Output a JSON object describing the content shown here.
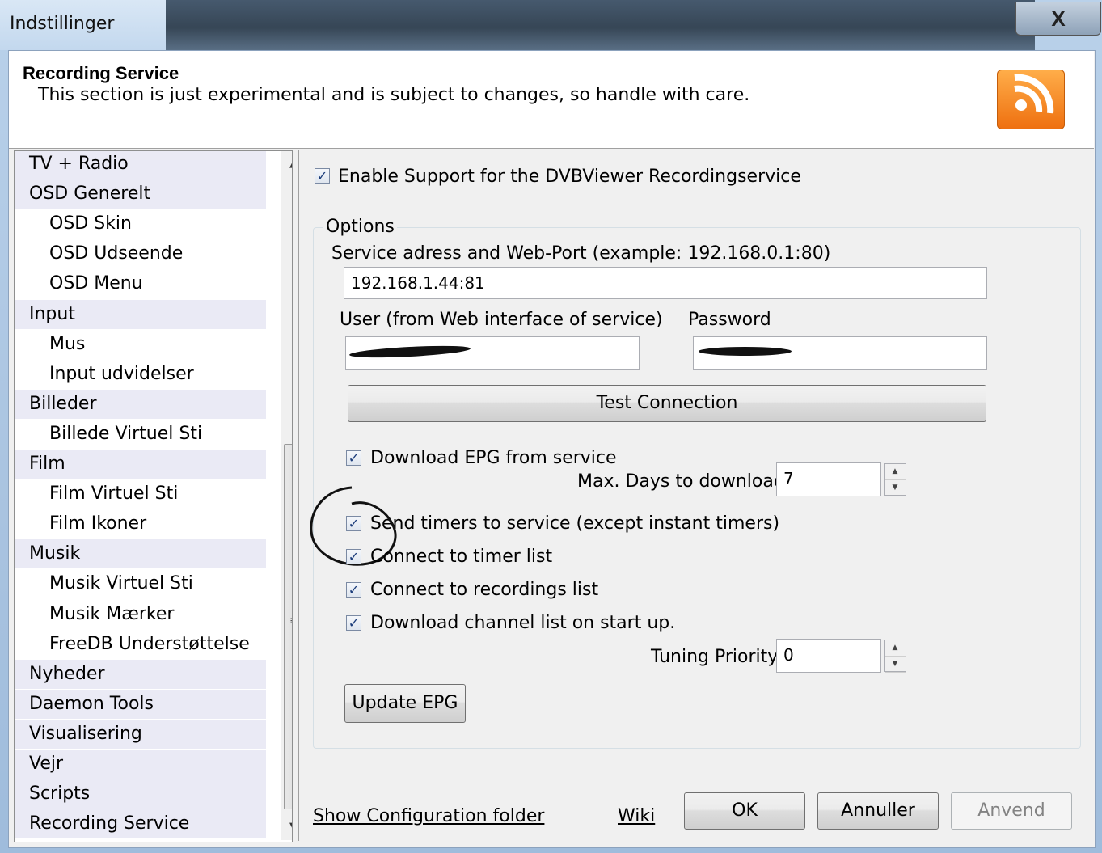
{
  "window": {
    "title": "Indstillinger",
    "close_glyph": "X"
  },
  "header": {
    "title": "Recording Service",
    "subtitle": "This section is just experimental and is subject to changes, so handle with care.",
    "logo_icon": "rss-feed-icon",
    "logo_color": "#f7891f"
  },
  "tree": {
    "items": [
      {
        "label": "TV + Radio",
        "level": 0
      },
      {
        "label": "OSD Generelt",
        "level": 0
      },
      {
        "label": "OSD Skin",
        "level": 1
      },
      {
        "label": "OSD Udseende",
        "level": 1
      },
      {
        "label": "OSD Menu",
        "level": 1
      },
      {
        "label": "Input",
        "level": 0
      },
      {
        "label": "Mus",
        "level": 1
      },
      {
        "label": "Input udvidelser",
        "level": 1
      },
      {
        "label": "Billeder",
        "level": 0
      },
      {
        "label": "Billede Virtuel Sti",
        "level": 1
      },
      {
        "label": "Film",
        "level": 0
      },
      {
        "label": "Film Virtuel Sti",
        "level": 1
      },
      {
        "label": "Film Ikoner",
        "level": 1
      },
      {
        "label": "Musik",
        "level": 0
      },
      {
        "label": "Musik Virtuel Sti",
        "level": 1
      },
      {
        "label": "Musik Mærker",
        "level": 1
      },
      {
        "label": "FreeDB Understøttelse",
        "level": 1
      },
      {
        "label": "Nyheder",
        "level": 0
      },
      {
        "label": "Daemon Tools",
        "level": 0
      },
      {
        "label": "Visualisering",
        "level": 0
      },
      {
        "label": "Vejr",
        "level": 0
      },
      {
        "label": "Scripts",
        "level": 0
      },
      {
        "label": "Recording Service",
        "level": 0
      }
    ],
    "scroll_up_glyph": "▲",
    "scroll_down_glyph": "▼",
    "grip_glyph": "≡"
  },
  "settings": {
    "enable_support": {
      "label": "Enable Support for the DVBViewer Recordingservice",
      "checked": true
    },
    "options_legend": "Options",
    "service_address_label": "Service adress and Web-Port (example: 192.168.0.1:80)",
    "service_address_value": "192.168.1.44:81",
    "user_label": "User (from Web interface of service)",
    "password_label": "Password",
    "test_connection_label": "Test Connection",
    "download_epg": {
      "label": "Download EPG from service",
      "checked": true
    },
    "max_days_label": "Max. Days to download",
    "max_days_value": "7",
    "send_timers": {
      "label": "Send timers to service (except instant timers)",
      "checked": true
    },
    "connect_timer_list": {
      "label": "Connect to timer list",
      "checked": true
    },
    "connect_recordings_list": {
      "label": "Connect to recordings list",
      "checked": true
    },
    "download_channel_list": {
      "label": "Download channel list on start up.",
      "checked": true
    },
    "tuning_priority_label": "Tuning Priority",
    "tuning_priority_value": "0",
    "update_epg_label": "Update EPG",
    "check_glyph": "✓",
    "spin_up_glyph": "▲",
    "spin_down_glyph": "▼"
  },
  "footer": {
    "show_config_folder": "Show Configuration folder",
    "wiki": "Wiki",
    "ok": "OK",
    "cancel": "Annuller",
    "apply": "Anvend"
  }
}
